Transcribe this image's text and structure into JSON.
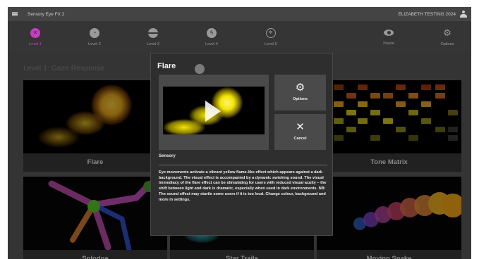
{
  "app": {
    "title": "Sensory Eye FX 2",
    "user_name": "ELIZABETH TESTING 2024",
    "menu_icon": "hamburger-icon",
    "user_icon": "person-icon"
  },
  "levels": [
    {
      "label": "Level 1",
      "icon": "eye-slash-icon",
      "active": true
    },
    {
      "label": "Level 2",
      "icon": "gauge-icon",
      "active": false
    },
    {
      "label": "Level 3",
      "icon": "ball-icon",
      "active": false
    },
    {
      "label": "Level 4",
      "icon": "bolt-icon",
      "active": false
    },
    {
      "label": "Level 5",
      "icon": "target-icon",
      "active": false
    },
    {
      "label": "Pause",
      "icon": "eye-icon",
      "active": false
    },
    {
      "label": "Options",
      "icon": "gear-icon",
      "active": false
    }
  ],
  "page_title": "Level 1: Gaze Response",
  "cards": [
    {
      "label": "Flare"
    },
    {
      "label": "Tone Matrix"
    },
    {
      "label": "Splodge"
    },
    {
      "label": "Star Trails"
    },
    {
      "label": "Moving Snake"
    }
  ],
  "modal": {
    "title": "Flare",
    "options_label": "Options",
    "cancel_label": "Cancel",
    "category": "Sensory",
    "description": "Eye movements activate a vibrant yellow flame-like effect which appears against a dark background. The visual effect is accompanied by a dynamic swishing sound. The visual immediacy of the flare effect can be stimulating for users with reduced visual acuity – the shift between light and dark is dramatic, especially when used in dark environments. NB: The sound effect may startle some users if it is too loud. Change colour, background and more in settings."
  },
  "colors": {
    "accent": "#c83cc8",
    "nav_background": "#353535",
    "app_background": "#5a5a5a",
    "flare_yellow": "#f2e600"
  }
}
